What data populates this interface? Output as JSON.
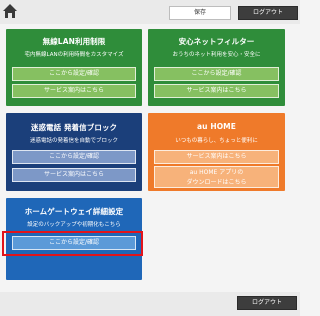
{
  "header": {
    "save_label": "保存",
    "logout_label": "ログアウト"
  },
  "cards": {
    "wlan": {
      "title": "無線LAN利用制限",
      "subtitle": "宅内無線LANの利用時間をカスタマイズ",
      "button1": "ここから設定/確認",
      "button2": "サービス案内はこちら"
    },
    "safe_net": {
      "title": "安心ネットフィルター",
      "subtitle": "おうちのネット利用を安心・安全に",
      "button1": "ここから設定/確認",
      "button2": "サービス案内はこちら"
    },
    "nuisance": {
      "title": "迷惑電話 発着信ブロック",
      "subtitle": "迷惑電話の発着信を自動でブロック",
      "button1": "ここから設定/確認",
      "button2": "サービス案内はこちら"
    },
    "au_home": {
      "title": "au HOME",
      "subtitle": "いつもの暮らし、ちょっと便利に",
      "button1": "サービス案内はこちら",
      "button2_line1": "au HOME アプリの",
      "button2_line2": "ダウンロードはこちら"
    },
    "gateway": {
      "title": "ホームゲートウェイ詳細設定",
      "subtitle": "設定のバックアップや初期化もこちら",
      "button1": "ここから設定/確認"
    }
  },
  "footer": {
    "logout_label": "ログアウト"
  },
  "colors": {
    "green": "#2f8d3a",
    "navy": "#1b3f7a",
    "orange": "#ef7a2a",
    "blue": "#1f67b8",
    "highlight": "#e2141b"
  }
}
